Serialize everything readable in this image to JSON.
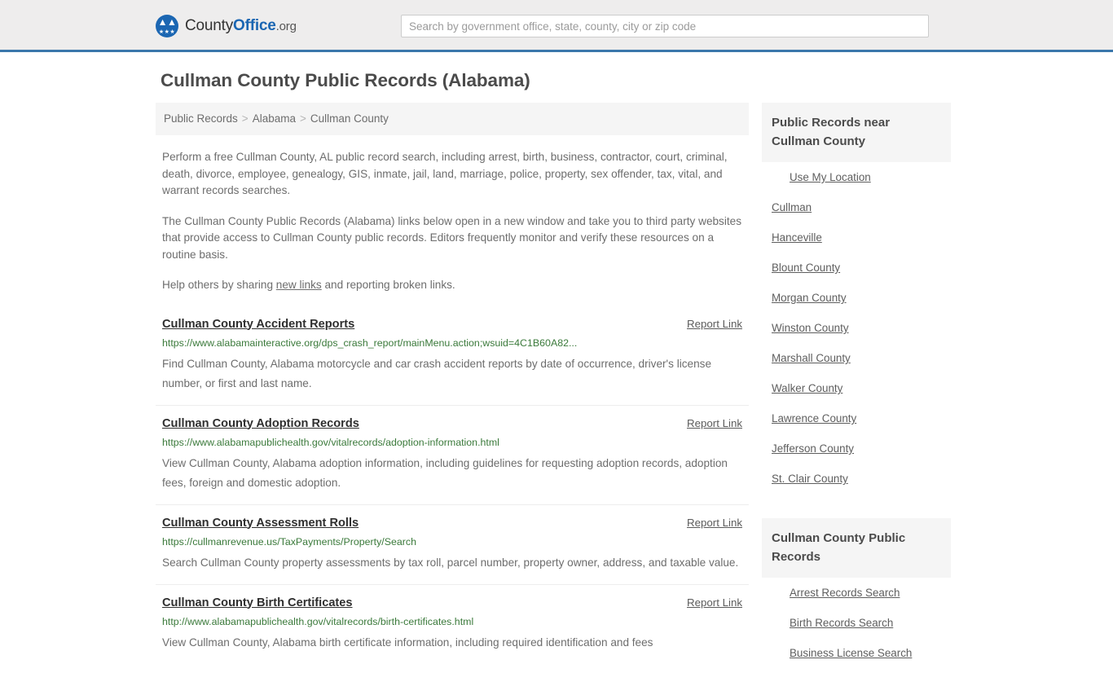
{
  "header": {
    "brand": {
      "county": "County",
      "office": "Office",
      "org": ".org",
      "eagle_icon": "eagle-crest-icon",
      "stars_icon": "three-stars-icon"
    },
    "search": {
      "placeholder": "Search by government office, state, county, city or zip code",
      "value": ""
    },
    "accent_color": "#3b77ab",
    "background_color": "#eeeded"
  },
  "page": {
    "title": "Cullman County Public Records (Alabama)"
  },
  "breadcrumb": {
    "items": [
      {
        "label": "Public Records"
      },
      {
        "label": "Alabama"
      },
      {
        "label": "Cullman County"
      }
    ],
    "separator": ">"
  },
  "intro": {
    "paragraph_1": "Perform a free Cullman County, AL public record search, including arrest, birth, business, contractor, court, criminal, death, divorce, employee, genealogy, GIS, inmate, jail, land, marriage, police, property, sex offender, tax, vital, and warrant records searches.",
    "paragraph_2": "The Cullman County Public Records (Alabama) links below open in a new window and take you to third party websites that provide access to Cullman County public records. Editors frequently monitor and verify these resources on a routine basis.",
    "paragraph_3_before": "Help others by sharing ",
    "paragraph_3_link": "new links",
    "paragraph_3_after": " and reporting broken links."
  },
  "results": {
    "report_label": "Report Link",
    "items": [
      {
        "title": "Cullman County Accident Reports",
        "url": "https://www.alabamainteractive.org/dps_crash_report/mainMenu.action;wsuid=4C1B60A82...",
        "description": "Find Cullman County, Alabama motorcycle and car crash accident reports by date of occurrence, driver's license number, or first and last name.",
        "report_label": "Report Link"
      },
      {
        "title": "Cullman County Adoption Records",
        "url": "https://www.alabamapublichealth.gov/vitalrecords/adoption-information.html",
        "description": "View Cullman County, Alabama adoption information, including guidelines for requesting adoption records, adoption fees, foreign and domestic adoption.",
        "report_label": "Report Link"
      },
      {
        "title": "Cullman County Assessment Rolls",
        "url": "https://cullmanrevenue.us/TaxPayments/Property/Search",
        "description": "Search Cullman County property assessments by tax roll, parcel number, property owner, address, and taxable value.",
        "report_label": "Report Link"
      },
      {
        "title": "Cullman County Birth Certificates",
        "url": "http://www.alabamapublichealth.gov/vitalrecords/birth-certificates.html",
        "description": "View Cullman County, Alabama birth certificate information, including required identification and fees",
        "report_label": "Report Link"
      }
    ]
  },
  "sidebar": {
    "nearby": {
      "heading": "Public Records near Cullman County",
      "items": [
        {
          "label": "Use My Location",
          "indent": true
        },
        {
          "label": "Cullman",
          "indent": false
        },
        {
          "label": "Hanceville",
          "indent": false
        },
        {
          "label": "Blount County",
          "indent": false
        },
        {
          "label": "Morgan County",
          "indent": false
        },
        {
          "label": "Winston County",
          "indent": false
        },
        {
          "label": "Marshall County",
          "indent": false
        },
        {
          "label": "Walker County",
          "indent": false
        },
        {
          "label": "Lawrence County",
          "indent": false
        },
        {
          "label": "Jefferson County",
          "indent": false
        },
        {
          "label": "St. Clair County",
          "indent": false
        }
      ]
    },
    "records": {
      "heading": "Cullman County Public Records",
      "items": [
        {
          "label": "Arrest Records Search",
          "indent": true
        },
        {
          "label": "Birth Records Search",
          "indent": true
        },
        {
          "label": "Business License Search",
          "indent": true
        }
      ]
    }
  }
}
